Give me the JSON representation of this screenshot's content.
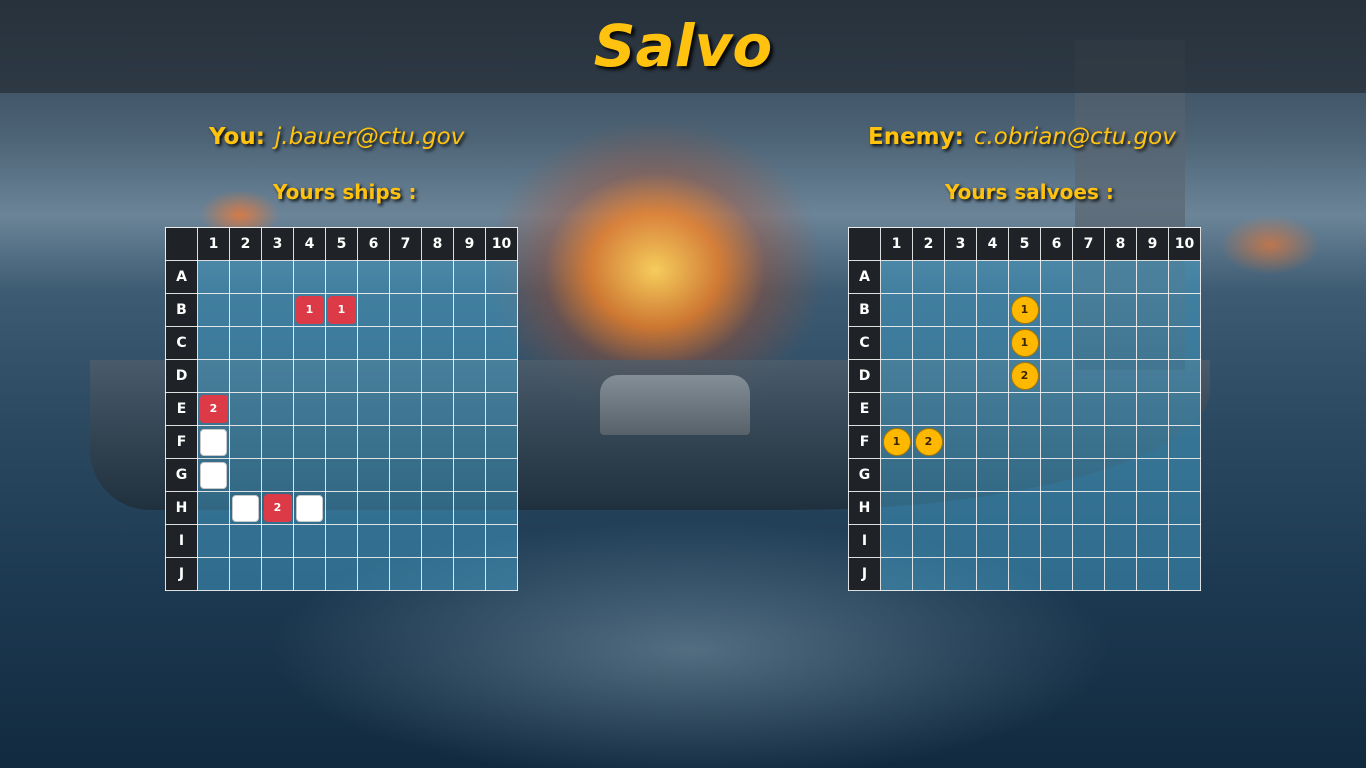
{
  "title": "Salvo",
  "player": {
    "role": "You:",
    "email": "j.bauer@ctu.gov"
  },
  "enemy": {
    "role": "Enemy:",
    "email": "c.obrian@ctu.gov"
  },
  "ships_label": "Yours ships :",
  "salvoes_label": "Yours salvoes :",
  "columns": [
    "1",
    "2",
    "3",
    "4",
    "5",
    "6",
    "7",
    "8",
    "9",
    "10"
  ],
  "rows": [
    "A",
    "B",
    "C",
    "D",
    "E",
    "F",
    "G",
    "H",
    "I",
    "J"
  ],
  "ships_grid": {
    "ship_cells": [
      "E1",
      "F1",
      "G1",
      "H2",
      "H3",
      "H4",
      "B4",
      "B5"
    ],
    "hits": {
      "B4": "1",
      "B5": "1",
      "E1": "2",
      "H3": "2"
    }
  },
  "salvoes_grid": {
    "salvoes": {
      "B5": "1",
      "C5": "1",
      "D5": "2",
      "F1": "1",
      "F2": "2"
    }
  },
  "colors": {
    "accent": "#ffc20e",
    "hit": "#dd3a47",
    "salvo": "#ffb800",
    "ship": "#ffffff",
    "header_cell": "#1f2226"
  }
}
